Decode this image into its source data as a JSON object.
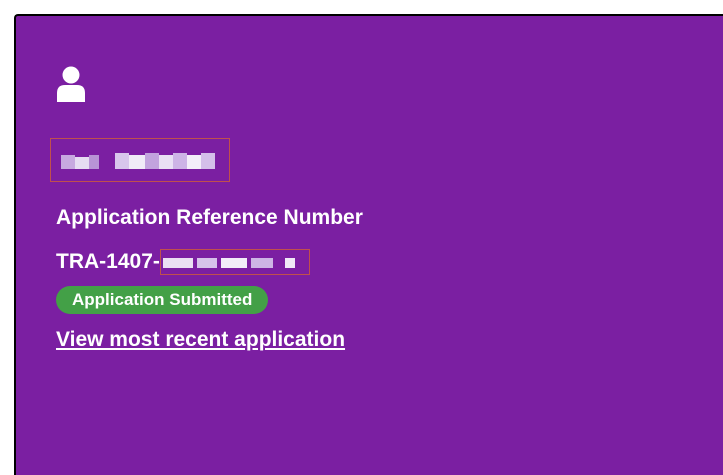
{
  "card": {
    "background_color": "#7b1fa2",
    "avatar_icon": "user-icon",
    "applicant_name": "",
    "reference_label": "Application Reference Number",
    "reference_prefix": "TRA-1407-",
    "status_badge": "Application Submitted",
    "status_color": "#43a047",
    "view_link": "View most recent application"
  }
}
